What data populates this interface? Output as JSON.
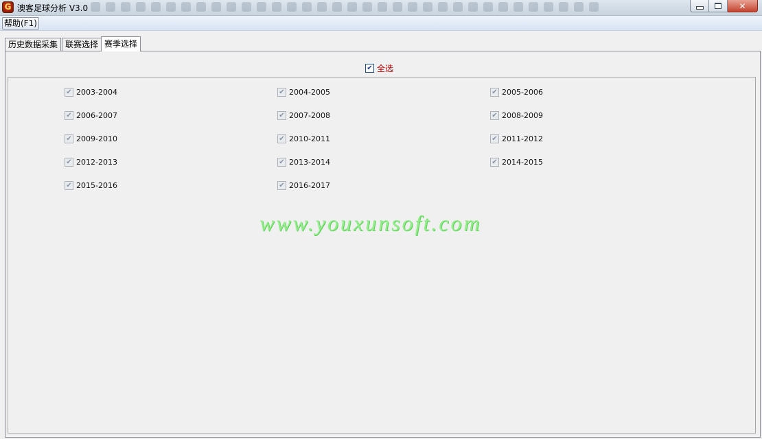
{
  "window": {
    "title": "澳客足球分析 V3.0",
    "close_glyph": "✕"
  },
  "menu": {
    "help": "帮助(F1)"
  },
  "tabs": [
    {
      "label": "历史数据采集",
      "active": false
    },
    {
      "label": "联赛选择",
      "active": false
    },
    {
      "label": "赛季选择",
      "active": true
    }
  ],
  "select_all": {
    "label": "全选",
    "checked": true
  },
  "seasons": [
    {
      "label": "2003-2004",
      "checked": true
    },
    {
      "label": "2004-2005",
      "checked": true
    },
    {
      "label": "2005-2006",
      "checked": true
    },
    {
      "label": "2006-2007",
      "checked": true
    },
    {
      "label": "2007-2008",
      "checked": true
    },
    {
      "label": "2008-2009",
      "checked": true
    },
    {
      "label": "2009-2010",
      "checked": true
    },
    {
      "label": "2010-2011",
      "checked": true
    },
    {
      "label": "2011-2012",
      "checked": true
    },
    {
      "label": "2012-2013",
      "checked": true
    },
    {
      "label": "2013-2014",
      "checked": true
    },
    {
      "label": "2014-2015",
      "checked": true
    },
    {
      "label": "2015-2016",
      "checked": true
    },
    {
      "label": "2016-2017",
      "checked": true
    }
  ],
  "watermark": "www.youxunsoft.com",
  "colors": {
    "select_all_label": "#c00000",
    "watermark": "#92ec8a",
    "checkmark": "#1c3f94"
  }
}
